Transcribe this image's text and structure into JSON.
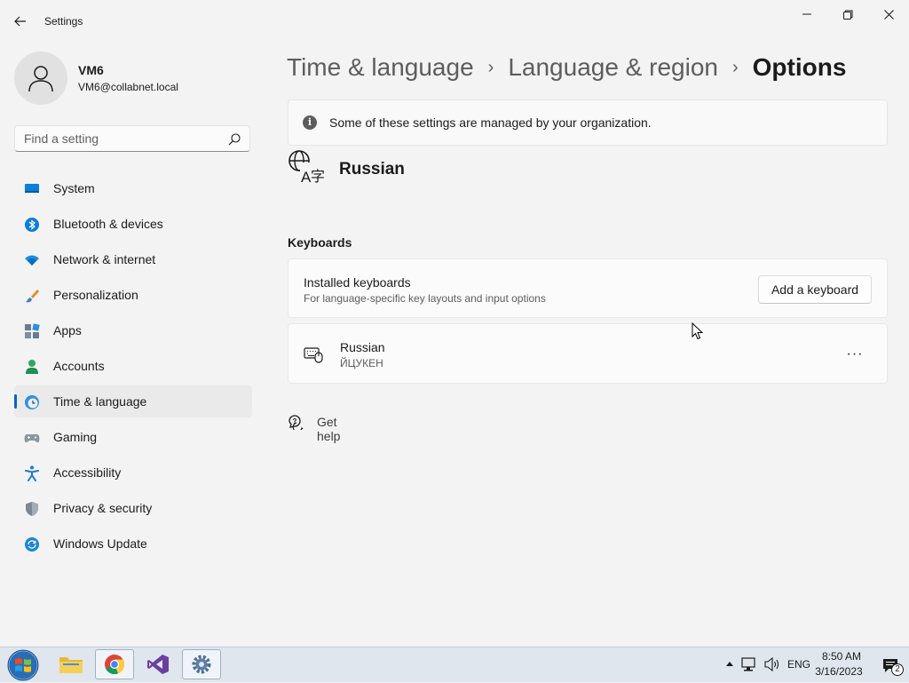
{
  "window": {
    "title": "Settings"
  },
  "user": {
    "name": "VM6",
    "email": "VM6@collabnet.local"
  },
  "search": {
    "placeholder": "Find a setting"
  },
  "sidebar": {
    "items": [
      {
        "label": "System",
        "icon": "system-icon"
      },
      {
        "label": "Bluetooth & devices",
        "icon": "bluetooth-icon"
      },
      {
        "label": "Network & internet",
        "icon": "network-icon"
      },
      {
        "label": "Personalization",
        "icon": "brush-icon"
      },
      {
        "label": "Apps",
        "icon": "apps-icon"
      },
      {
        "label": "Accounts",
        "icon": "accounts-icon"
      },
      {
        "label": "Time & language",
        "icon": "time-language-icon",
        "active": true
      },
      {
        "label": "Gaming",
        "icon": "gaming-icon"
      },
      {
        "label": "Accessibility",
        "icon": "accessibility-icon"
      },
      {
        "label": "Privacy & security",
        "icon": "shield-icon"
      },
      {
        "label": "Windows Update",
        "icon": "windows-update-icon"
      }
    ]
  },
  "breadcrumb": {
    "part1": "Time & language",
    "part2": "Language & region",
    "current": "Options",
    "separator": "›"
  },
  "info": {
    "text": "Some of these settings are managed by your organization.",
    "icon": "info-icon"
  },
  "language": {
    "name": "Russian",
    "icon": "language-icon"
  },
  "keyboards": {
    "section_title": "Keyboards",
    "installed_title": "Installed keyboards",
    "installed_subtitle": "For language-specific key layouts and input options",
    "add_button": "Add a keyboard",
    "items": [
      {
        "name": "Russian",
        "layout": "ЙЦУКЕН",
        "icon": "keyboard-icon"
      }
    ],
    "more_label": "···"
  },
  "help": {
    "label": "Get help"
  },
  "taskbar": {
    "apps": [
      {
        "name": "file-explorer-icon"
      },
      {
        "name": "chrome-icon"
      },
      {
        "name": "visual-studio-icon"
      },
      {
        "name": "settings-icon"
      }
    ],
    "language": "ENG",
    "time": "8:50 AM",
    "date": "3/16/2023",
    "notification_count": "2"
  },
  "colors": {
    "accent": "#0067c0",
    "background": "#f3f3f3",
    "card": "#fbfbfb"
  }
}
